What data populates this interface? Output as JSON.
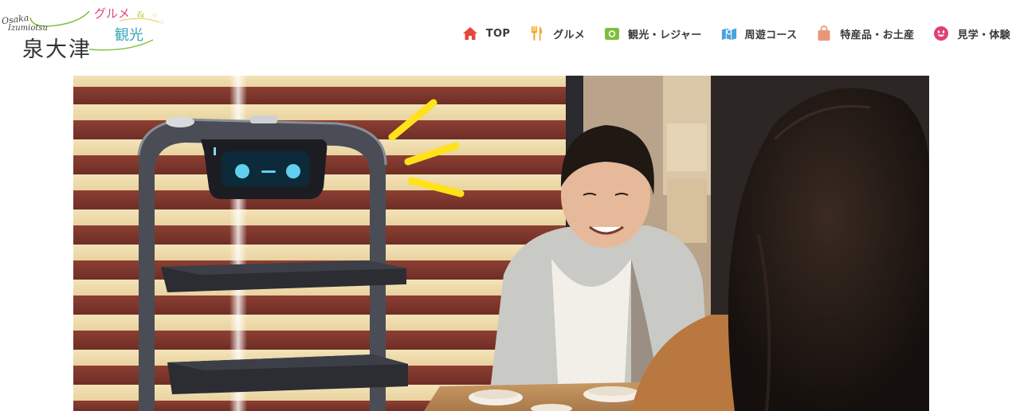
{
  "site": {
    "logo": {
      "romaji_line1": "Osaka",
      "romaji_line2": "Izumiotsu",
      "main_text": "泉大津",
      "tag_gourmet": "グルメ",
      "tag_amp": "&",
      "tag_kanko": "観光"
    }
  },
  "nav": {
    "items": [
      {
        "label": "TOP",
        "icon": "home-icon",
        "color": "#e8463a"
      },
      {
        "label": "グルメ",
        "icon": "fork-knife-icon",
        "color": "#f5a623"
      },
      {
        "label": "観光・レジャー",
        "icon": "camera-icon",
        "color": "#7cbf3a"
      },
      {
        "label": "周遊コース",
        "icon": "map-icon",
        "color": "#4aa3df"
      },
      {
        "label": "特産品・お土産",
        "icon": "shopping-bag-icon",
        "color": "#e8977a"
      },
      {
        "label": "見学・体験",
        "icon": "smile-icon",
        "color": "#e0407a"
      }
    ]
  },
  "hero": {
    "image": "restaurant-serving-robot-photo"
  }
}
